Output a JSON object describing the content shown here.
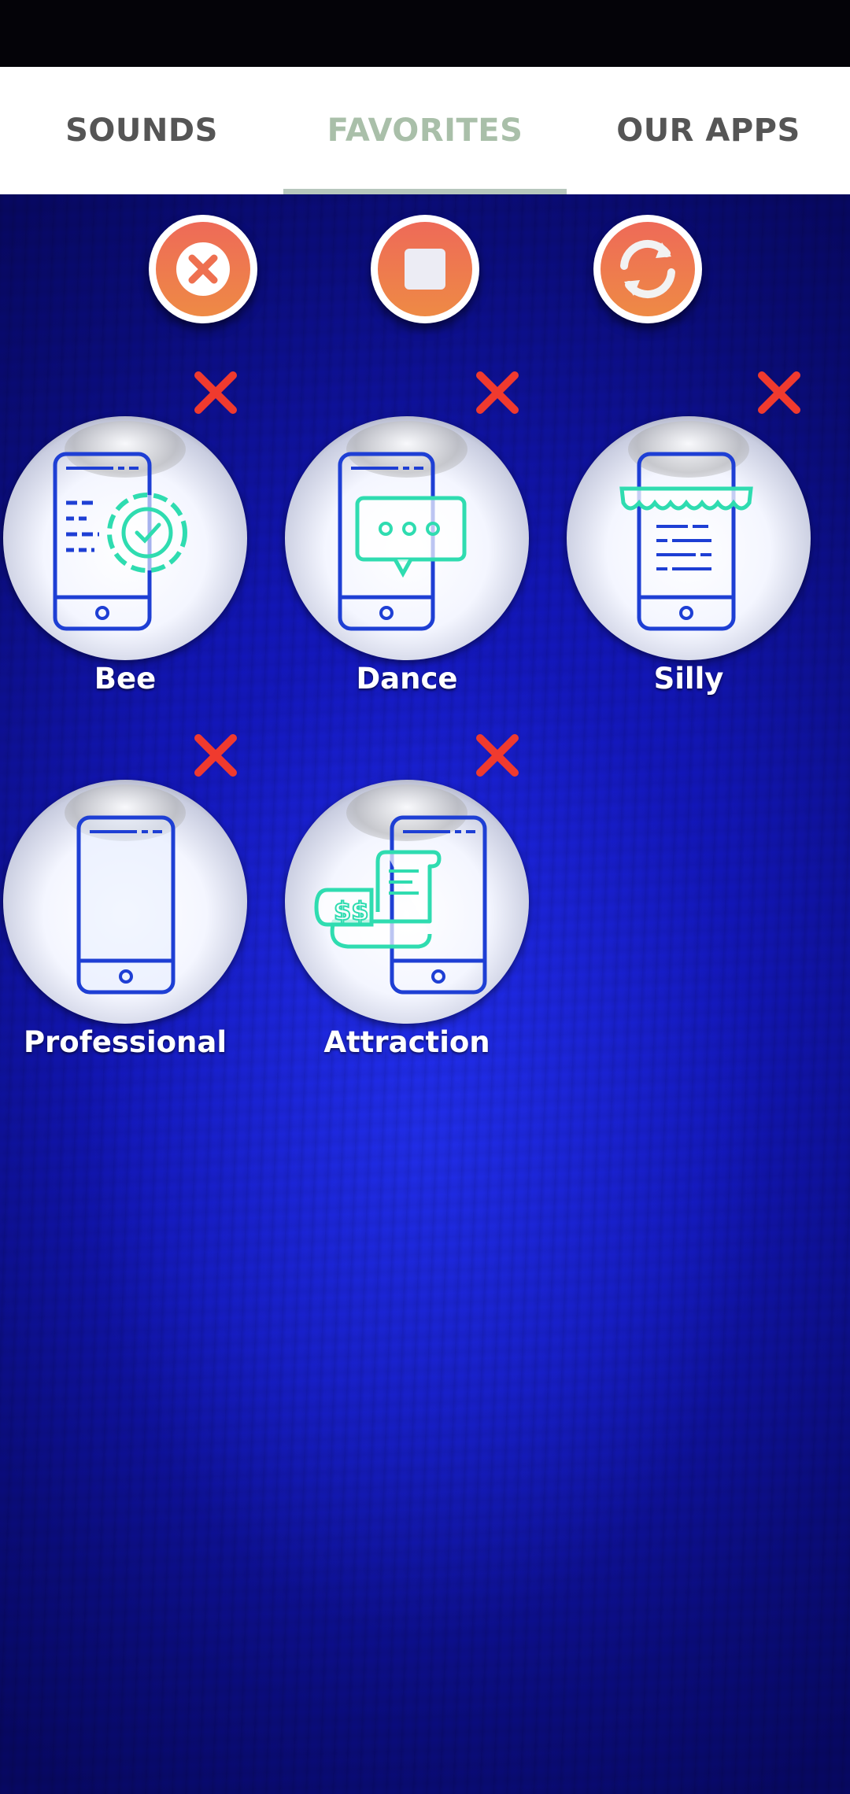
{
  "tabs": [
    {
      "label": "SOUNDS",
      "active": false
    },
    {
      "label": "FAVORITES",
      "active": true
    },
    {
      "label": "OUR APPS",
      "active": false
    }
  ],
  "controls": [
    {
      "icon": "close-circle-icon"
    },
    {
      "icon": "stop-icon"
    },
    {
      "icon": "refresh-icon"
    }
  ],
  "favorites": [
    {
      "label": "Bee",
      "icon": "phone-gear-icon"
    },
    {
      "label": "Dance",
      "icon": "phone-chat-icon"
    },
    {
      "label": "Silly",
      "icon": "phone-shop-icon"
    },
    {
      "label": "Professional",
      "icon": "phone-icon"
    },
    {
      "label": "Attraction",
      "icon": "phone-receipt-icon"
    }
  ],
  "colors": {
    "status_bar": "#040308",
    "tab_active": "#a9bfa9",
    "tab_inactive": "#555555",
    "background": "#1216b6",
    "control_button": "#ee7a50",
    "delete_mark": "#f03a2e",
    "icon_blue": "#1e3fd4",
    "icon_teal": "#2fdcb0"
  }
}
